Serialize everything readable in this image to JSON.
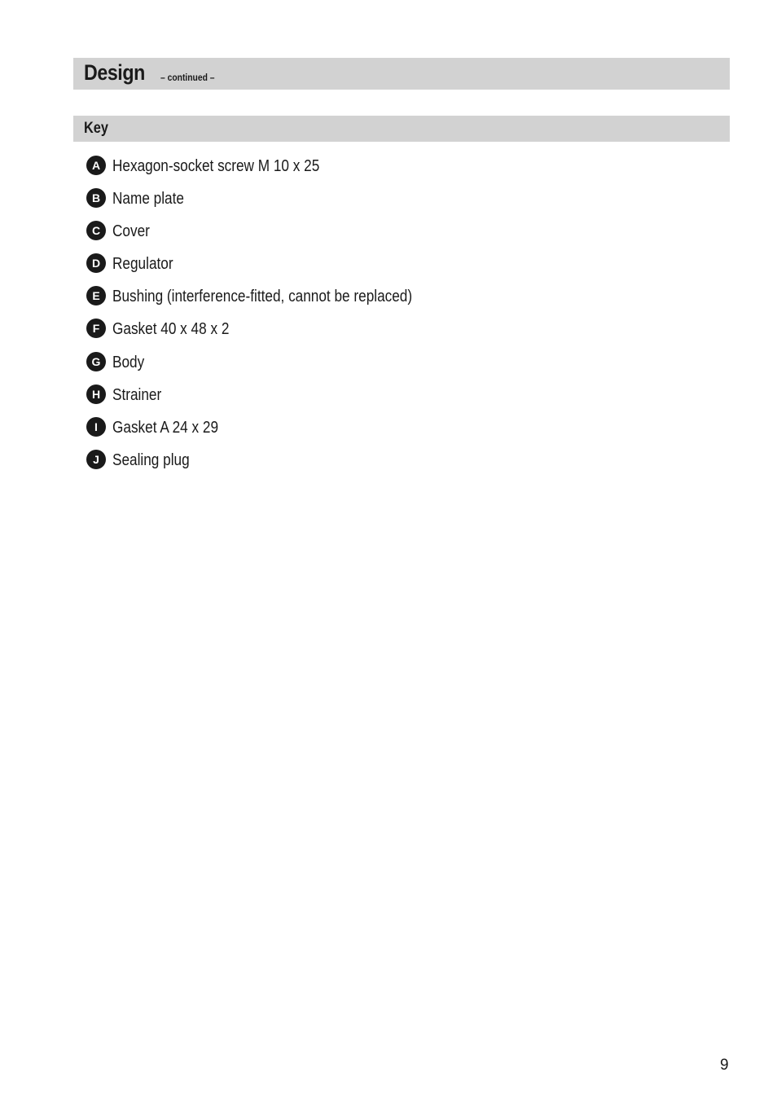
{
  "header": {
    "title": "Design",
    "subtitle": "– continued –"
  },
  "key": {
    "title": "Key",
    "items": [
      {
        "letter": "A",
        "label": "Hexagon-socket screw M 10 x 25"
      },
      {
        "letter": "B",
        "label": "Name plate"
      },
      {
        "letter": "C",
        "label": "Cover"
      },
      {
        "letter": "D",
        "label": "Regulator"
      },
      {
        "letter": "E",
        "label": "Bushing (interference-fitted, cannot be replaced)"
      },
      {
        "letter": "F",
        "label": "Gasket 40 x 48 x 2"
      },
      {
        "letter": "G",
        "label": "Body"
      },
      {
        "letter": "H",
        "label": "Strainer"
      },
      {
        "letter": "I",
        "label": "Gasket A 24 x 29"
      },
      {
        "letter": "J",
        "label": "Sealing plug"
      }
    ]
  },
  "footer": {
    "page_number": "9"
  }
}
